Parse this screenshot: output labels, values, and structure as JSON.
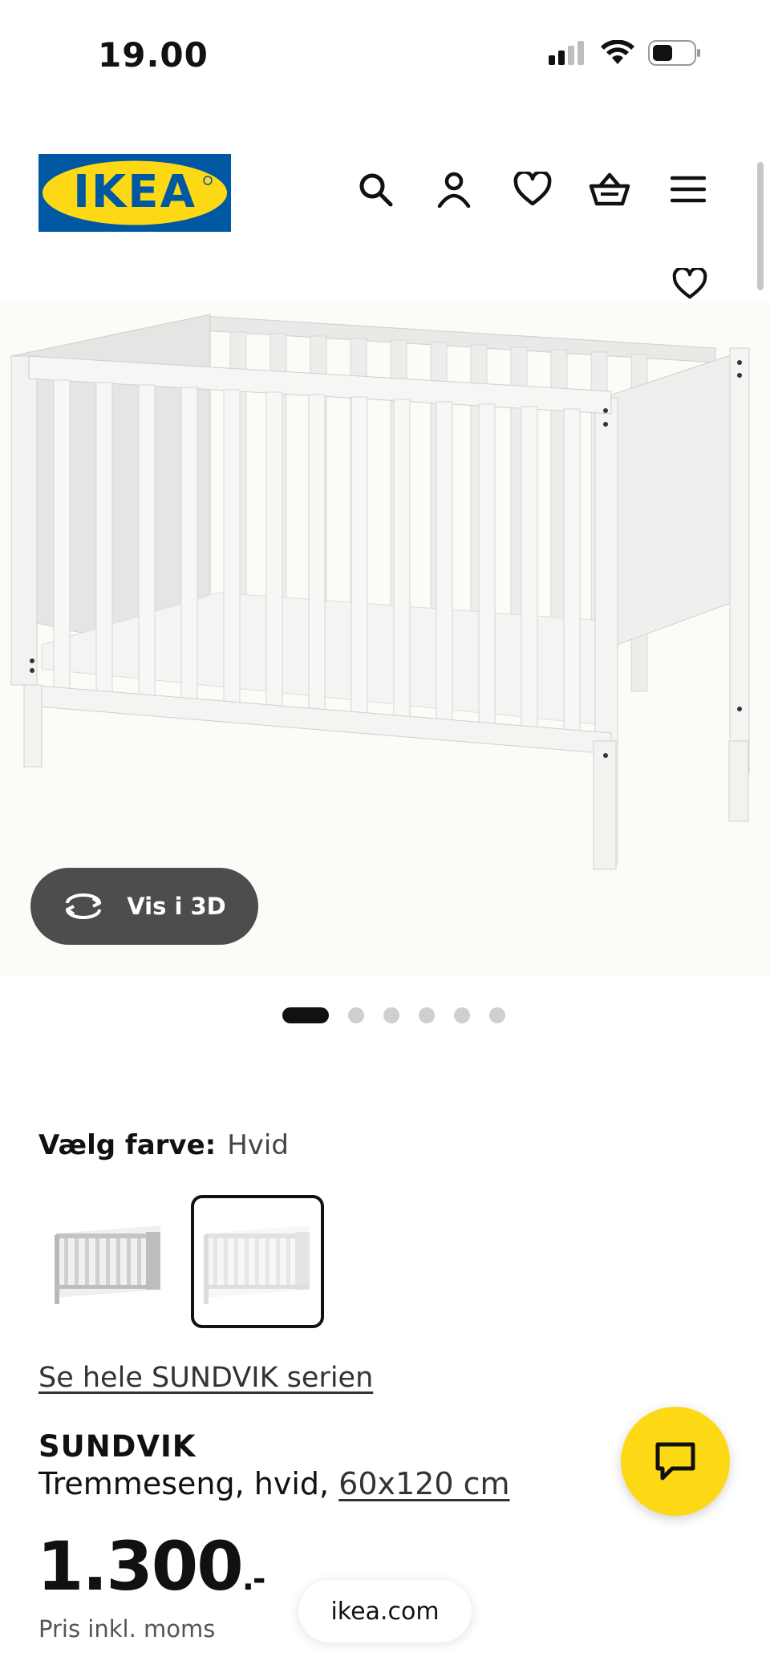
{
  "status_bar": {
    "time": "19.00",
    "icons": [
      "cellular-signal-icon",
      "wifi-icon",
      "battery-icon"
    ]
  },
  "header": {
    "logo_text": "IKEA",
    "nav_icons": [
      "search-icon",
      "account-icon",
      "heart-icon",
      "shopping-basket-icon",
      "menu-icon"
    ]
  },
  "gallery": {
    "view_3d_label": "Vis i 3D",
    "image_count": 6,
    "active_index": 0
  },
  "color_select": {
    "label": "Vælg farve:",
    "value": "Hvid",
    "options": [
      "grey-crib",
      "white-crib"
    ],
    "selected_index": 1
  },
  "product": {
    "series_link": "Se hele SUNDVIK serien",
    "name": "SUNDVIK",
    "description": "Tremmeseng, hvid, ",
    "size_link": "60x120 cm",
    "price": "1.300",
    "price_suffix": ".-",
    "price_note": "Pris inkl. moms"
  },
  "browser": {
    "url": "ikea.com"
  },
  "colors": {
    "ikea_blue": "#0058a3",
    "ikea_yellow": "#fdd915",
    "button_dark": "#4d4d4d"
  }
}
